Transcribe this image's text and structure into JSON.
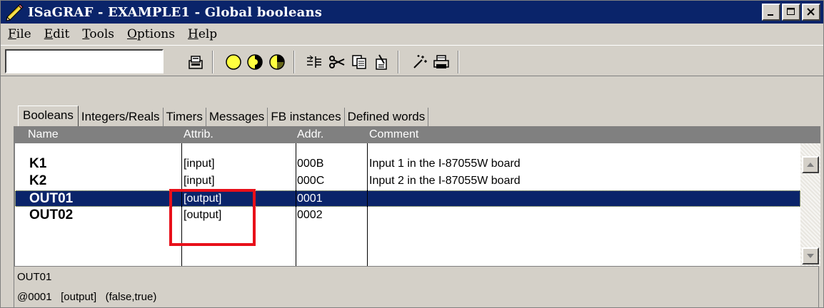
{
  "window": {
    "title": "ISaGRAF - EXAMPLE1 - Global booleans",
    "title_icon": "isagraf-pencil-icon",
    "controls": [
      "minimize-icon",
      "maximize-icon",
      "close-icon"
    ]
  },
  "menu": [
    {
      "underline": "F",
      "rest": "ile"
    },
    {
      "underline": "E",
      "rest": "dit"
    },
    {
      "underline": "T",
      "rest": "ools"
    },
    {
      "underline": "O",
      "rest": "ptions"
    },
    {
      "underline": "H",
      "rest": "elp"
    }
  ],
  "toolbar": {
    "combo_value": "",
    "icons": [
      "open-library-icon",
      "yellow-circle-icon",
      "half-circle-icon",
      "pie-icon",
      "insert-row-icon",
      "scissors-icon",
      "copy-icon",
      "paste-icon",
      "wand-icon",
      "printer-icon"
    ]
  },
  "tabs": [
    "Booleans",
    "Integers/Reals",
    "Timers",
    "Messages",
    "FB instances",
    "Defined words"
  ],
  "grid": {
    "columns": [
      "Name",
      "Attrib.",
      "Addr.",
      "Comment"
    ],
    "rows": [
      {
        "name": "K1",
        "attrib": "[input]",
        "addr": "000B",
        "comment": "Input 1 in the I-87055W board"
      },
      {
        "name": "K2",
        "attrib": "[input]",
        "addr": "000C",
        "comment": "Input 2 in the I-87055W board"
      },
      {
        "name": "OUT01",
        "attrib": "[output]",
        "addr": "0001",
        "comment": ""
      },
      {
        "name": "OUT02",
        "attrib": "[output]",
        "addr": "0002",
        "comment": ""
      }
    ],
    "selected_row": "OUT01"
  },
  "status": {
    "line1": "OUT01",
    "line2": "@0001   [output]   (false,true)"
  },
  "colors": {
    "titlebar": "#0a246a",
    "selection": "#0a246a",
    "highlight_box": "#e8101a",
    "face": "#d4d0c8"
  }
}
